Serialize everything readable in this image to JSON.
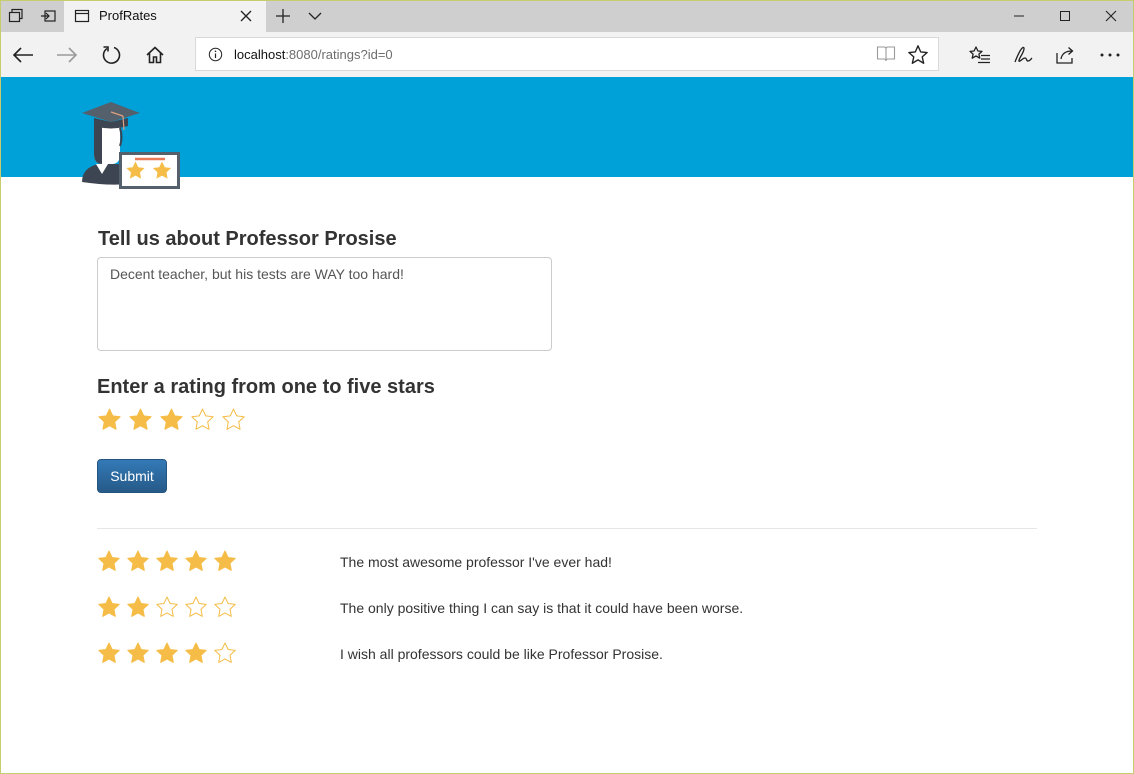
{
  "browser": {
    "tab_title": "ProfRates",
    "url_host": "localhost",
    "url_rest": ":8080/ratings?id=0",
    "icons": [
      "tab-preview-icon",
      "set-tabs-aside-icon",
      "page-favicon",
      "tab-close-icon",
      "new-tab-icon",
      "tab-list-chevron-icon",
      "minimize-icon",
      "maximize-icon",
      "close-window-icon",
      "back-icon",
      "forward-icon",
      "refresh-icon",
      "home-icon",
      "site-info-icon",
      "reading-view-icon",
      "favorite-star-icon",
      "favorites-hub-icon",
      "web-note-icon",
      "share-icon",
      "more-icon"
    ]
  },
  "colors": {
    "banner": "#00a0d8",
    "star_fill": "#f5bd47",
    "star_outline": "#f5bd47",
    "button": "#2e6da4"
  },
  "form": {
    "comment_heading": "Tell us about Professor Prosise",
    "comment_value": "Decent teacher, but his tests are WAY too hard!",
    "rating_heading": "Enter a rating from one to five stars",
    "rating_value": 3,
    "rating_max": 5,
    "submit_label": "Submit"
  },
  "reviews": [
    {
      "rating": 5,
      "text": "The most awesome professor I've ever had!"
    },
    {
      "rating": 2,
      "text": "The only positive thing I can say is that it could have been worse."
    },
    {
      "rating": 4,
      "text": "I wish all professors could be like Professor Prosise."
    }
  ]
}
